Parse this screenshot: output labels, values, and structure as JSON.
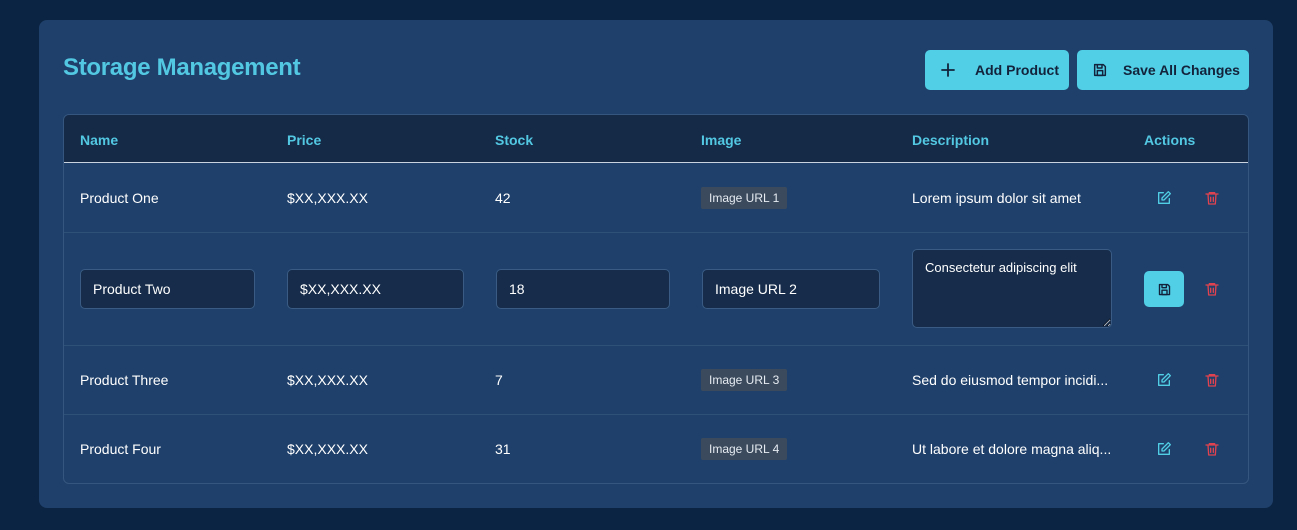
{
  "header": {
    "title": "Storage Management",
    "add_label": "Add Product",
    "save_all_label": "Save All Changes"
  },
  "columns": [
    "Name",
    "Price",
    "Stock",
    "Image",
    "Description",
    "Actions"
  ],
  "rows": [
    {
      "name": "Product One",
      "price": "$XX,XXX.XX",
      "stock": "42",
      "image": "Image URL 1",
      "description": "Lorem ipsum dolor sit amet",
      "editing": false
    },
    {
      "name": "Product Two",
      "price": "$XX,XXX.XX",
      "stock": "18",
      "image": "Image URL 2",
      "description": "Consectetur adipiscing elit",
      "editing": true
    },
    {
      "name": "Product Three",
      "price": "$XX,XXX.XX",
      "stock": "7",
      "image": "Image URL 3",
      "description": "Sed do eiusmod tempor incidi...",
      "editing": false
    },
    {
      "name": "Product Four",
      "price": "$XX,XXX.XX",
      "stock": "31",
      "image": "Image URL 4",
      "description": "Ut labore et dolore magna aliq...",
      "editing": false
    }
  ],
  "icons": {
    "add": "plus-icon",
    "save_all": "floppy-disk-icon",
    "edit": "edit-icon",
    "delete": "trash-icon",
    "save_row": "floppy-disk-icon"
  },
  "colors": {
    "background": "#0c2443",
    "card": "#1f406a",
    "accent": "#51cfe6",
    "delete": "#e0434f",
    "header_text": "#53c8e3"
  }
}
